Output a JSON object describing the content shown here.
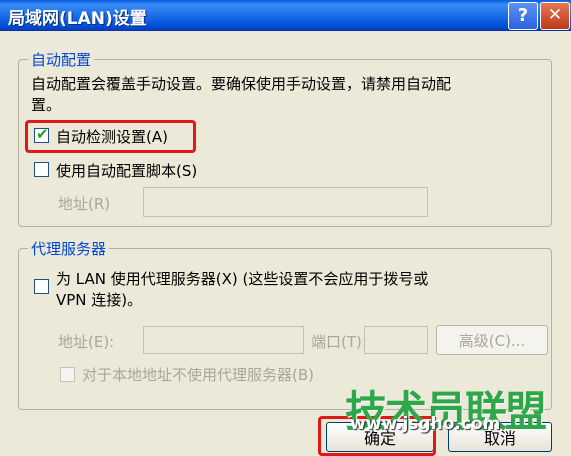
{
  "window": {
    "title": "局域网(LAN)设置",
    "help_glyph": "?",
    "close_glyph": "✕"
  },
  "auto_config": {
    "group_label": "自动配置",
    "description_line1": "自动配置会覆盖手动设置。要确保使用手动设置，请禁用自动配",
    "description_line2": "置。",
    "detect_label": "自动检测设置(A)",
    "detect_checked": true,
    "script_label": "使用自动配置脚本(S)",
    "script_checked": false,
    "address_label": "地址(R)",
    "address_value": ""
  },
  "proxy": {
    "group_label": "代理服务器",
    "use_proxy_line1": "为 LAN 使用代理服务器(X) (这些设置不会应用于拨号或",
    "use_proxy_line2": "VPN 连接)。",
    "use_proxy_checked": false,
    "address_label": "地址(E):",
    "address_value": "",
    "port_label": "端口(T):",
    "port_value": "",
    "advanced_label": "高级(C)...",
    "bypass_label": "对于本地地址不使用代理服务器(B)",
    "bypass_checked": false
  },
  "footer": {
    "ok_label": "确定",
    "cancel_label": "取消"
  },
  "watermark": {
    "text": "技术员联盟",
    "url": "www.jsgho.com"
  },
  "colors": {
    "titlebar": "#1d6fe9",
    "highlight": "#e01818",
    "group_label": "#0046d5",
    "watermark": "#2ea64a"
  }
}
